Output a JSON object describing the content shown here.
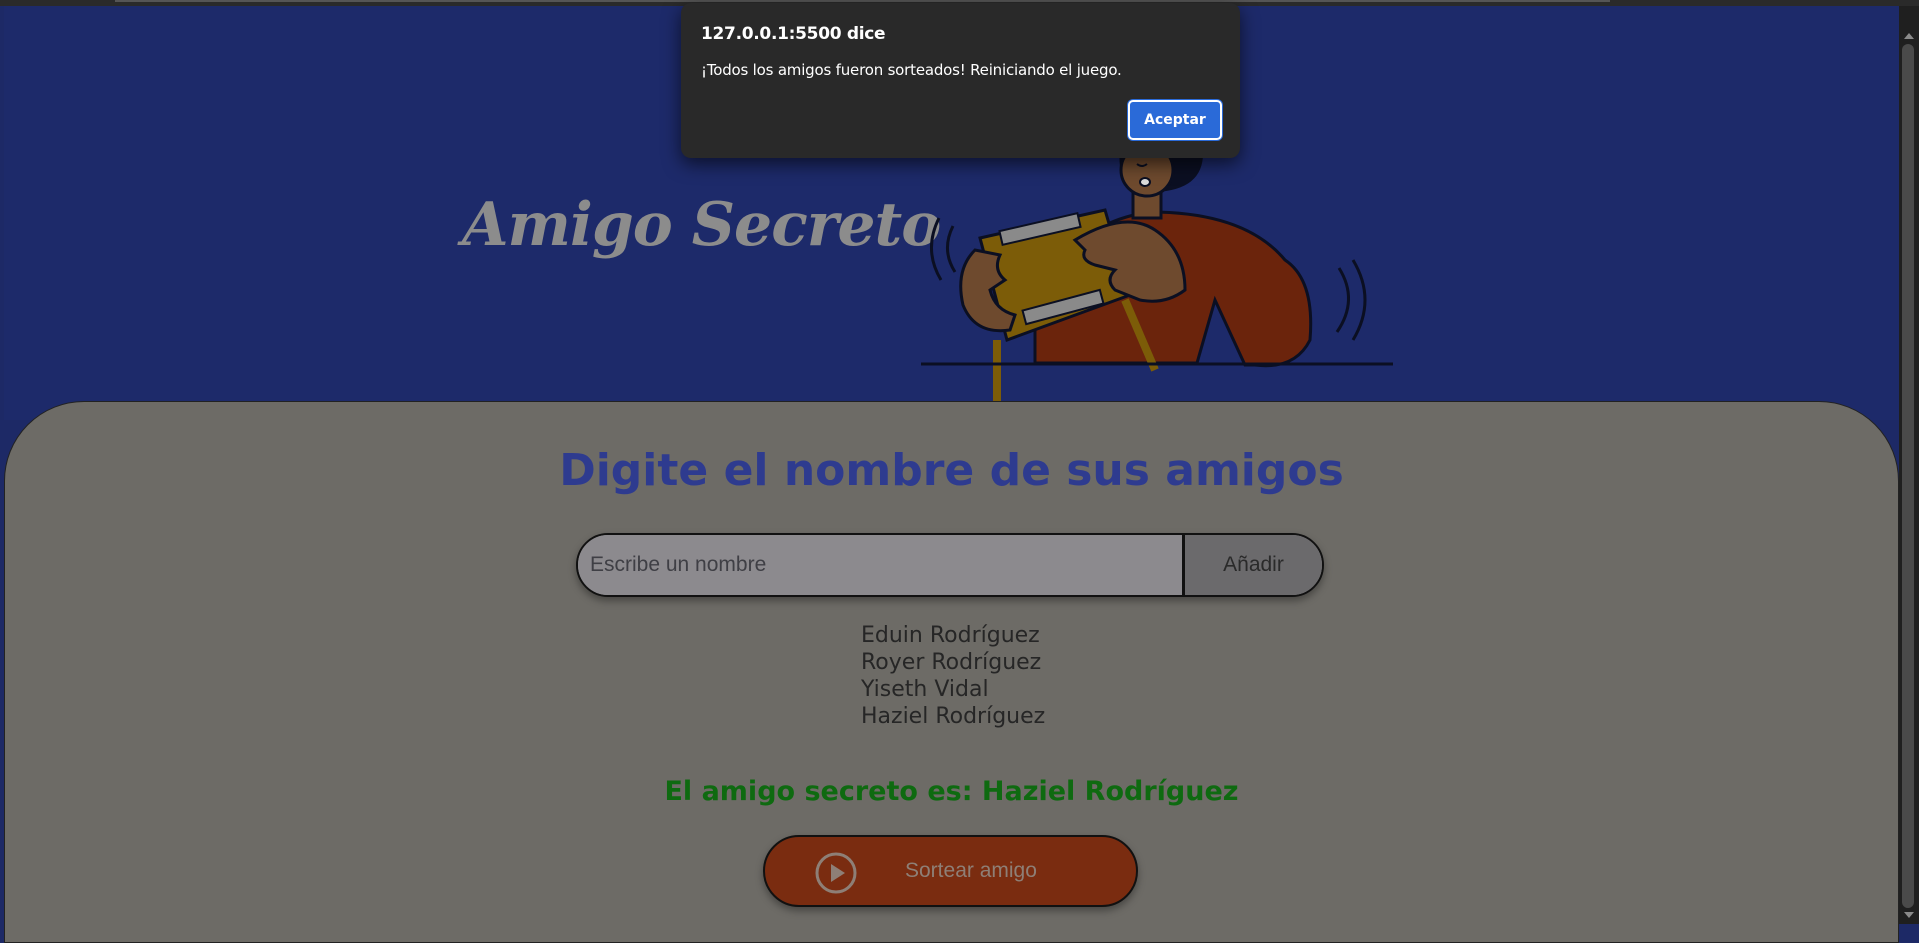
{
  "app": {
    "title": "Amigo Secreto"
  },
  "main": {
    "heading": "Digite el nombre de sus amigos",
    "input_placeholder": "Escribe un nombre",
    "add_button_label": "Añadir",
    "friends": [
      "Eduin Rodríguez",
      "Royer Rodríguez",
      "Yiseth Vidal",
      "Haziel Rodríguez"
    ],
    "result_text": "El amigo secreto es: Haziel Rodríguez",
    "draw_button_label": "Sortear amigo"
  },
  "dialog": {
    "title": "127.0.0.1:5500 dice",
    "message": "¡Todos los amigos fueron sorteados! Reiniciando el juego.",
    "ok_label": "Aceptar"
  },
  "icons": {
    "draw_button_icon": "play-circle-icon"
  },
  "colors": {
    "header_bg": "#1d2a6a",
    "main_bg": "#6d6b66",
    "heading": "#2e3b8f",
    "result": "#0e6a10",
    "draw_button_bg": "#7a2c10",
    "dialog_bg": "#292929",
    "dialog_ok_bg": "#2a6ad8"
  }
}
